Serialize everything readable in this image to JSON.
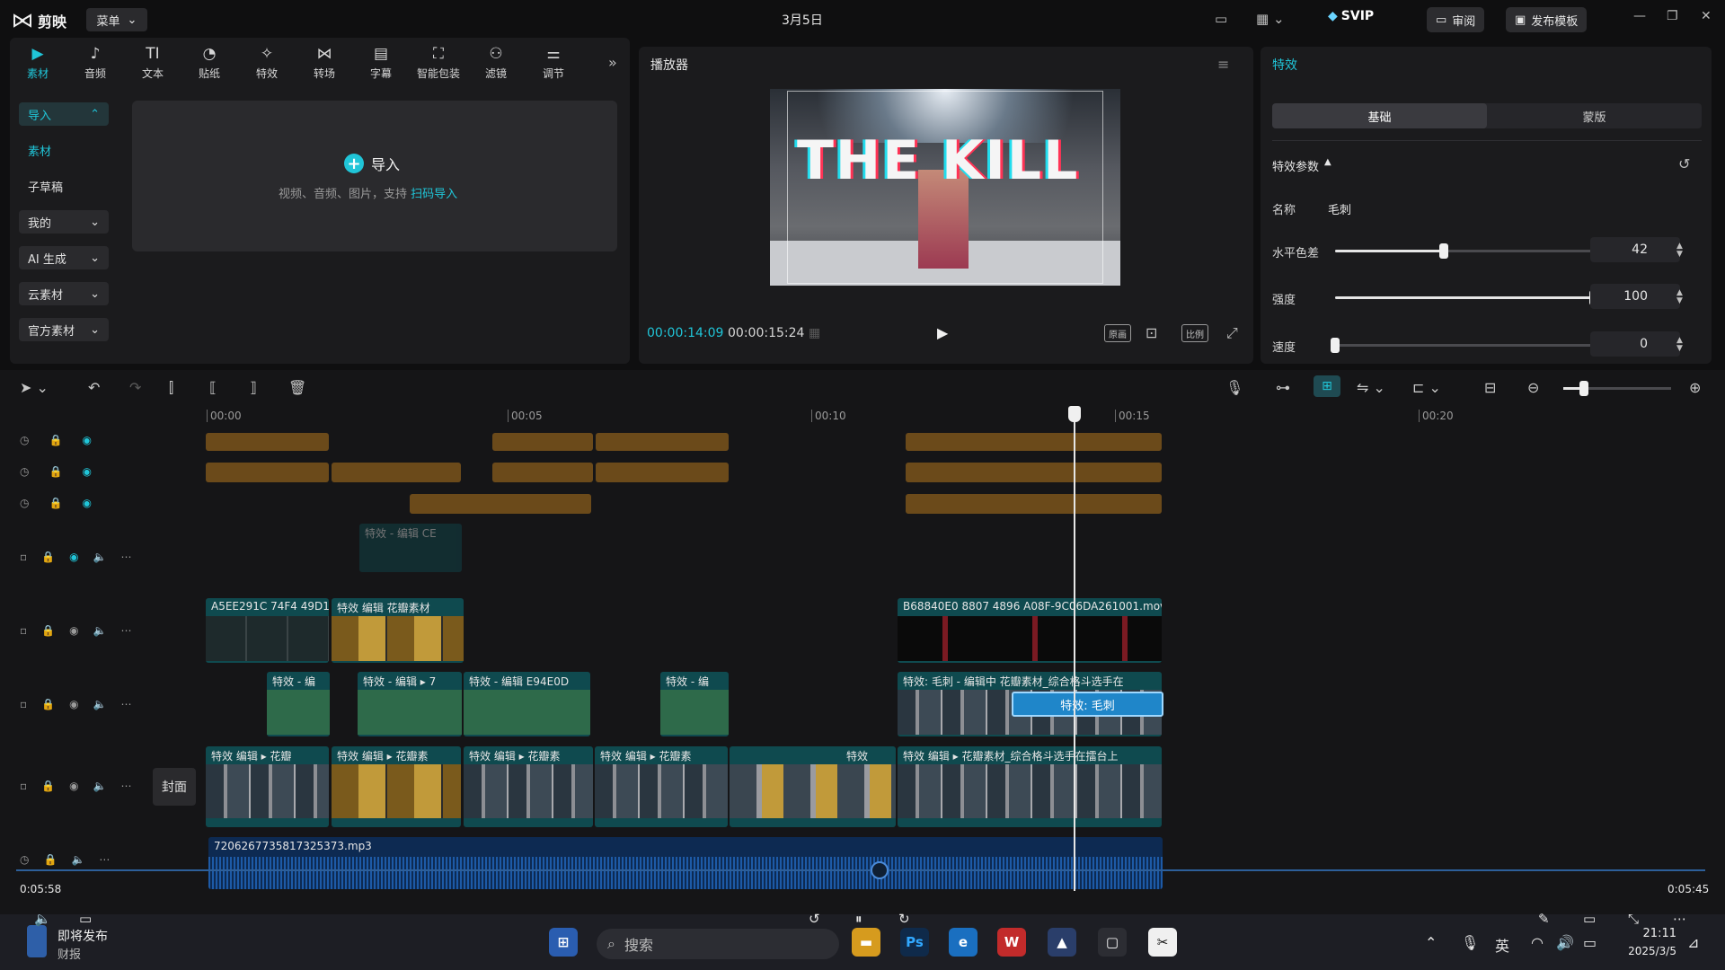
{
  "app": {
    "name": "剪映",
    "menu_label": "菜单",
    "date_title": "3月5日",
    "svip": "SVIP",
    "review_btn": "审阅",
    "publish_btn": "发布模板"
  },
  "toolbar": [
    {
      "label": "素材",
      "icon": "▶"
    },
    {
      "label": "音频",
      "icon": "♪"
    },
    {
      "label": "文本",
      "icon": "TI"
    },
    {
      "label": "贴纸",
      "icon": "◔"
    },
    {
      "label": "特效",
      "icon": "✧"
    },
    {
      "label": "转场",
      "icon": "⋈"
    },
    {
      "label": "字幕",
      "icon": "▤"
    },
    {
      "label": "智能包装",
      "icon": "⛶"
    },
    {
      "label": "滤镜",
      "icon": "⚇"
    },
    {
      "label": "调节",
      "icon": "⚌"
    }
  ],
  "sidenav": [
    {
      "label": "导入",
      "arrow": "⌃"
    },
    {
      "label": "素材",
      "arrow": ""
    },
    {
      "label": "子草稿",
      "arrow": ""
    },
    {
      "label": "我的",
      "arrow": "⌄"
    },
    {
      "label": "AI 生成",
      "arrow": "⌄"
    },
    {
      "label": "云素材",
      "arrow": "⌄"
    },
    {
      "label": "官方素材",
      "arrow": "⌄"
    }
  ],
  "import": {
    "button": "导入",
    "hint": "视频、音频、图片，支持",
    "link": "扫码导入"
  },
  "player": {
    "title": "播放器",
    "current_time": "00:00:14:09",
    "total_time": "00:00:15:24",
    "video_text": "THE KILL",
    "ratio_label": "比例",
    "original_label": "原画"
  },
  "effects": {
    "title": "特效",
    "tabs": [
      "基础",
      "蒙版"
    ],
    "section": "特效参数",
    "name_label": "名称",
    "name_value": "毛刺",
    "params": [
      {
        "label": "水平色差",
        "value": "42",
        "fraction": 0.42
      },
      {
        "label": "强度",
        "value": "100",
        "fraction": 1.0
      },
      {
        "label": "速度",
        "value": "0",
        "fraction": 0.0
      }
    ]
  },
  "timeline": {
    "ruler": [
      "00:00",
      "00:05",
      "00:10",
      "00:15",
      "00:20"
    ],
    "cover_label": "封面",
    "audio_file": "7206267735817325373.mp3",
    "left_time": "0:05:58",
    "right_time": "0:05:45",
    "clips": {
      "effect_ghost": "特效 - 编辑 CE",
      "v2_a": "A5EE291C 74F4 49D1",
      "v2_b": "特效  编辑  花瓣素材",
      "v2_c": "B68840E0 8807 4896 A08F-9C06DA261001.mov",
      "v3_a": "特效 - 编",
      "v3_b": "特效 - 编辑 ▸ 7",
      "v3_c": "特效 - 编辑  E94E0D",
      "v3_d": "特效 - 编",
      "v3_e": "特效: 毛刺 - 编辑中  花瓣素材_综合格斗选手在",
      "v3_selected": "特效: 毛刺",
      "main_a": "特效  编辑 ▸  花瓣",
      "main_b": "特效  编辑 ▸  花瓣素",
      "main_c": "特效  编辑 ▸  花瓣素",
      "main_d": "特效  编辑 ▸  花瓣素",
      "main_e": "特效",
      "main_f": "特效  编辑 ▸  花瓣素材_综合格斗选手在擂台上"
    }
  },
  "taskbar": {
    "notify_title": "即将发布",
    "notify_sub": "财报",
    "search": "搜索",
    "time": "21:11",
    "date": "2025/3/5",
    "ime": "英"
  },
  "colors": {
    "accent": "#20c5d8",
    "clip_teal": "#0f4a4f",
    "clip_orange": "#6b4a1a",
    "audio_blue": "#0d2a52"
  }
}
